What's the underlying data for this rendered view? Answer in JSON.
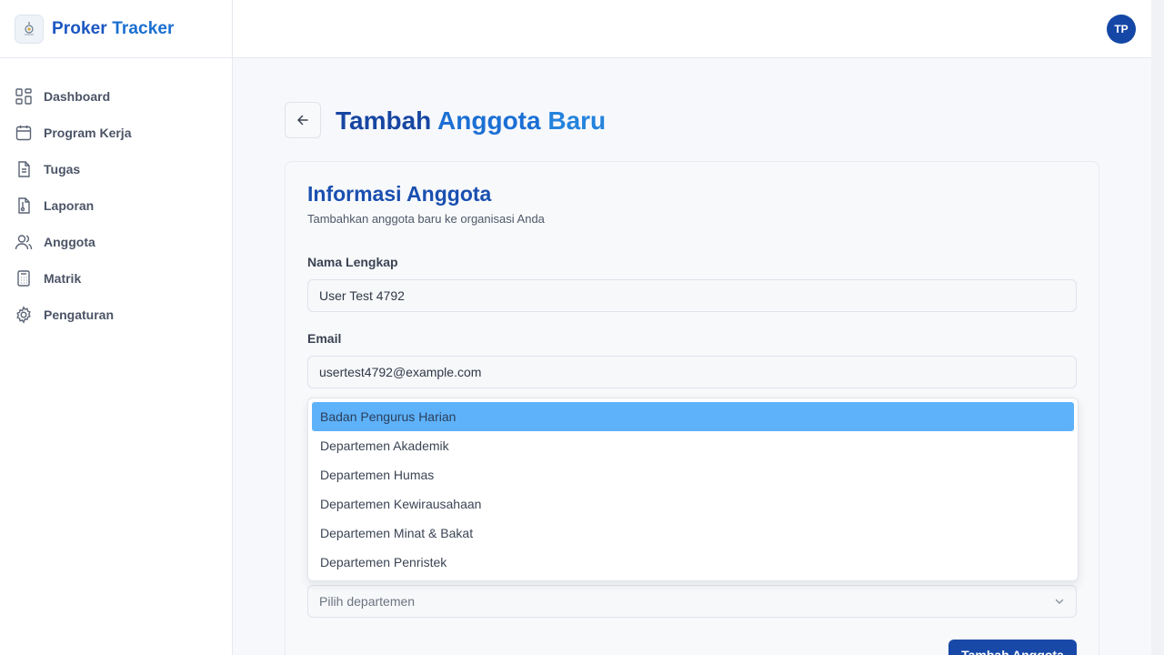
{
  "brand": {
    "name_part1": "Proker",
    "name_part2": "Tracker"
  },
  "user": {
    "initials": "TP"
  },
  "sidebar": {
    "items": [
      {
        "label": "Dashboard",
        "icon": "dashboard-icon"
      },
      {
        "label": "Program Kerja",
        "icon": "calendar-icon"
      },
      {
        "label": "Tugas",
        "icon": "document-icon"
      },
      {
        "label": "Laporan",
        "icon": "report-file-icon"
      },
      {
        "label": "Anggota",
        "icon": "users-icon"
      },
      {
        "label": "Matrik",
        "icon": "calculator-icon"
      },
      {
        "label": "Pengaturan",
        "icon": "gear-icon"
      }
    ]
  },
  "page": {
    "title_part1": "Tambah",
    "title_part2": "Anggota",
    "title_part3": "Baru"
  },
  "form": {
    "title": "Informasi Anggota",
    "subtitle": "Tambahkan anggota baru ke organisasi Anda",
    "name_label": "Nama Lengkap",
    "name_value": "User Test 4792",
    "email_label": "Email",
    "email_value": "usertest4792@example.com",
    "department_placeholder": "Pilih departemen",
    "department_options": [
      "Badan Pengurus Harian",
      "Departemen Akademik",
      "Departemen Humas",
      "Departemen Kewirausahaan",
      "Departemen Minat & Bakat",
      "Departemen Penristek"
    ],
    "highlighted_option": "Badan Pengurus Harian",
    "submit_label": "Tambah Anggota"
  },
  "colors": {
    "primary": "#1849a8",
    "accent": "#1b6fd4",
    "highlight": "#5eb2fa"
  }
}
